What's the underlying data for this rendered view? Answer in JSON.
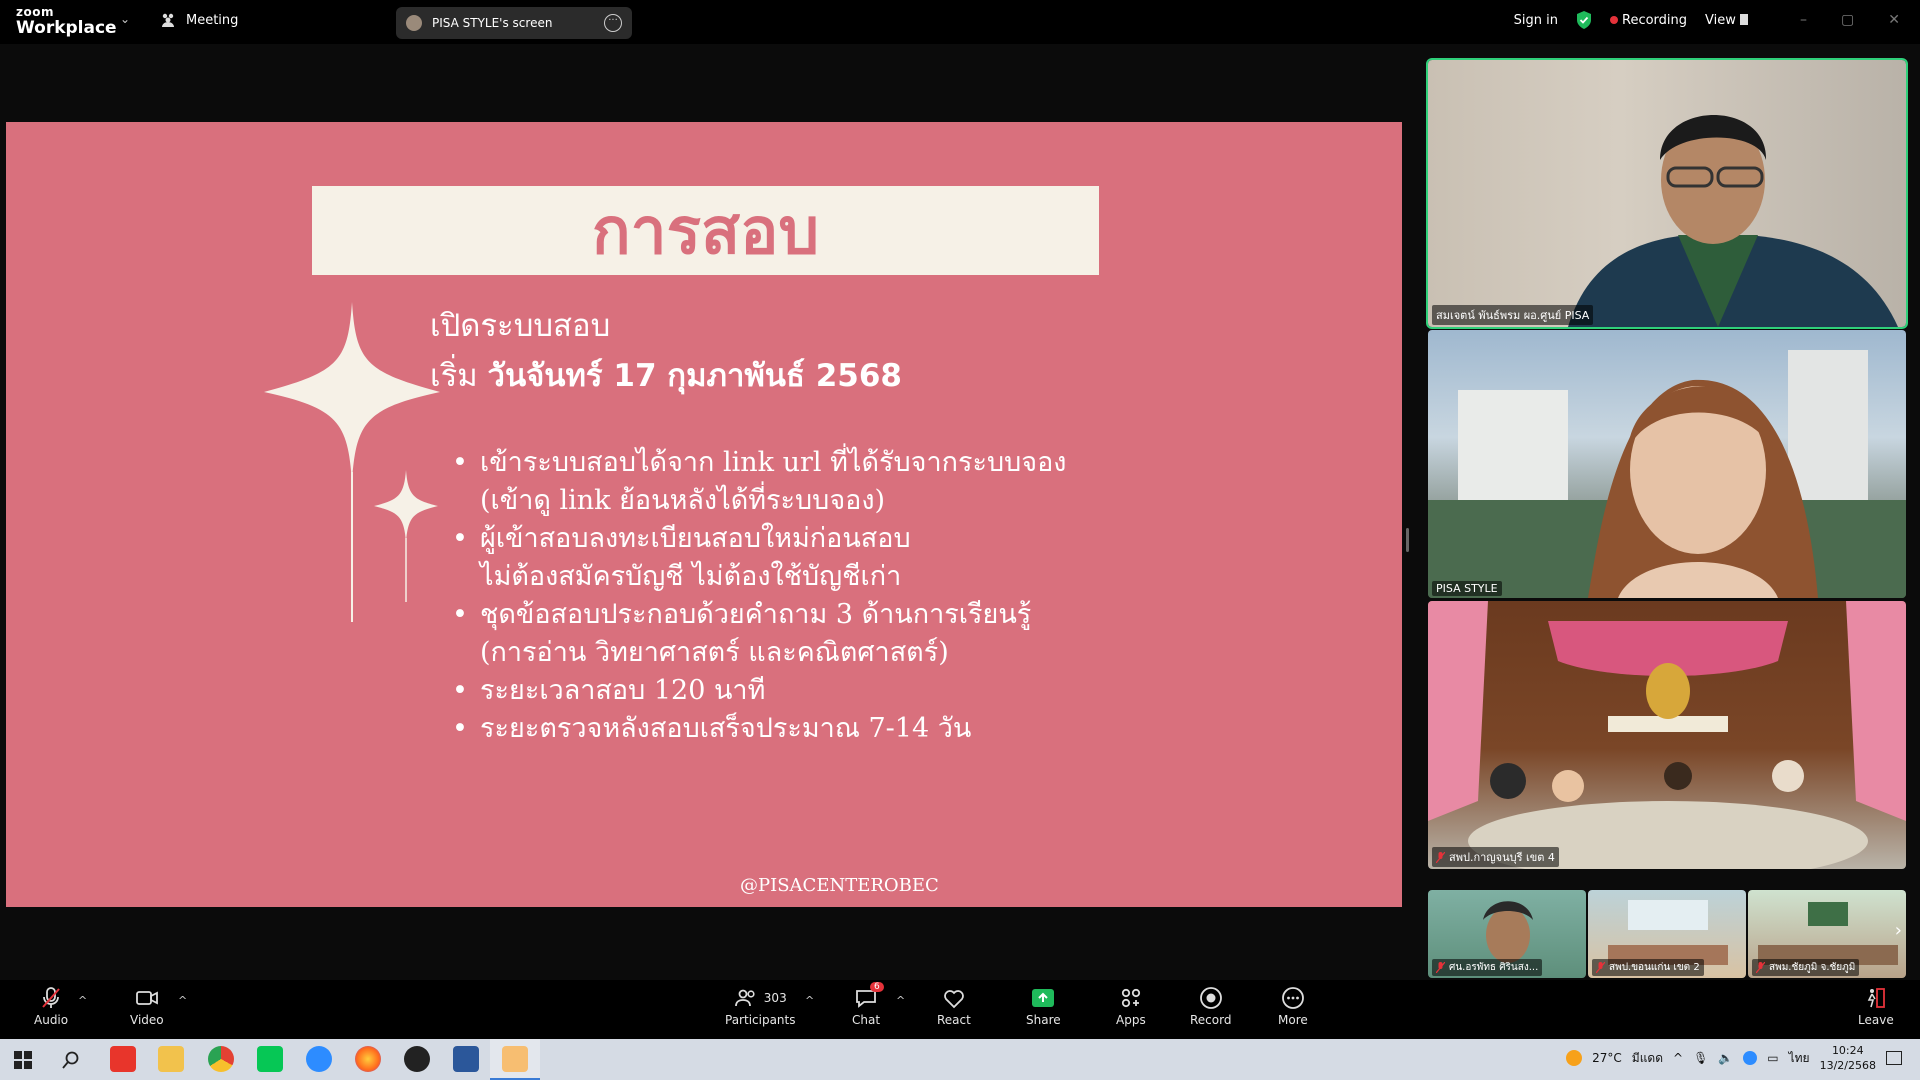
{
  "app": {
    "logo_small": "zoom",
    "logo_main": "Workplace"
  },
  "topbar": {
    "meeting_label": "Meeting",
    "screen_tab_label": "PISA STYLE's screen",
    "sign_in": "Sign in",
    "recording": "Recording",
    "view": "View"
  },
  "slide": {
    "title": "การสอบ",
    "line1": "เปิดระบบสอบ",
    "line2_prefix": "เริ่ม",
    "line2_bold": "วันจันทร์ 17 กุมภาพันธ์ 2568",
    "bullets": [
      {
        "line1": "เข้าระบบสอบได้จาก link url ที่ได้รับจากระบบจอง",
        "line2": "(เข้าดู link ย้อนหลังได้ที่ระบบจอง)"
      },
      {
        "line1": "ผู้เข้าสอบลงทะเบียนสอบใหม่ก่อนสอบ",
        "line2": "ไม่ต้องสมัครบัญชี ไม่ต้องใช้บัญชีเก่า"
      },
      {
        "line1": "ชุดข้อสอบประกอบด้วยคำถาม 3 ด้านการเรียนรู้",
        "line2": "(การอ่าน วิทยาศาสตร์ และคณิตศาสตร์)"
      },
      {
        "line1": "ระยะเวลาสอบ 120 นาที",
        "line2": ""
      },
      {
        "line1": "ระยะตรวจหลังสอบเสร็จประมาณ 7-14 วัน",
        "line2": ""
      }
    ],
    "handle": "@PISACENTEROBEC"
  },
  "participants_tiles": [
    {
      "name": "สมเจตน์ พันธ์พรม ผอ.ศูนย์ PISA"
    },
    {
      "name": "PISA STYLE"
    },
    {
      "name": "สพป.กาญจนบุรี เขต 4"
    }
  ],
  "thumb_tiles": [
    {
      "name": "ศน.อรพัทธ ศิรินสง..."
    },
    {
      "name": "สพป.ขอนแก่น เขต 2"
    },
    {
      "name": "สพม.ชัยภูมิ จ.ชัยภูมิ"
    }
  ],
  "toolbar": {
    "audio": "Audio",
    "video": "Video",
    "participants": "Participants",
    "participants_count": "303",
    "chat": "Chat",
    "chat_badge": "6",
    "react": "React",
    "share": "Share",
    "apps": "Apps",
    "record": "Record",
    "more": "More",
    "leave": "Leave"
  },
  "taskbar": {
    "temp": "27°C",
    "weather": "มีแดด",
    "lang": "ไทย",
    "time": "10:24",
    "date": "13/2/2568"
  },
  "colors": {
    "slide_bg": "#d9707d",
    "title_bg": "#f6f1e7",
    "active_border": "#2fd07a",
    "share_green": "#1fba5b"
  }
}
